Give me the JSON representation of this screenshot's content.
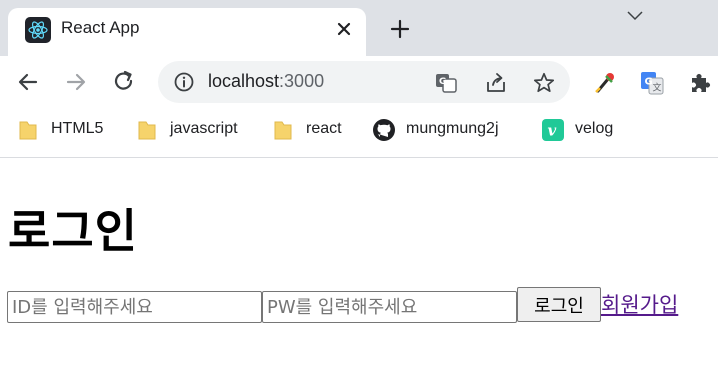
{
  "browser": {
    "tab": {
      "title": "React App",
      "favicon": "react-icon"
    },
    "address_bar": {
      "host": "localhost",
      "port": ":3000"
    },
    "bookmarks": [
      {
        "label": "HTML5",
        "icon": "folder-icon"
      },
      {
        "label": "javascript",
        "icon": "folder-icon"
      },
      {
        "label": "react",
        "icon": "folder-icon"
      },
      {
        "label": "mungmung2j",
        "icon": "github-icon"
      },
      {
        "label": "velog",
        "icon": "velog-icon"
      }
    ],
    "colors": {
      "tabstrip": "#dee1e6",
      "omnibox": "#f1f3f4",
      "folder": "#f6d36b",
      "velog": "#20c997",
      "link": "#551a8b"
    }
  },
  "page": {
    "title": "로그인",
    "id_input": {
      "placeholder": "ID를 입력해주세요",
      "value": ""
    },
    "pw_input": {
      "placeholder": "PW를 입력해주세요",
      "value": ""
    },
    "login_button": "로그인",
    "signup_link": "회원가입"
  }
}
